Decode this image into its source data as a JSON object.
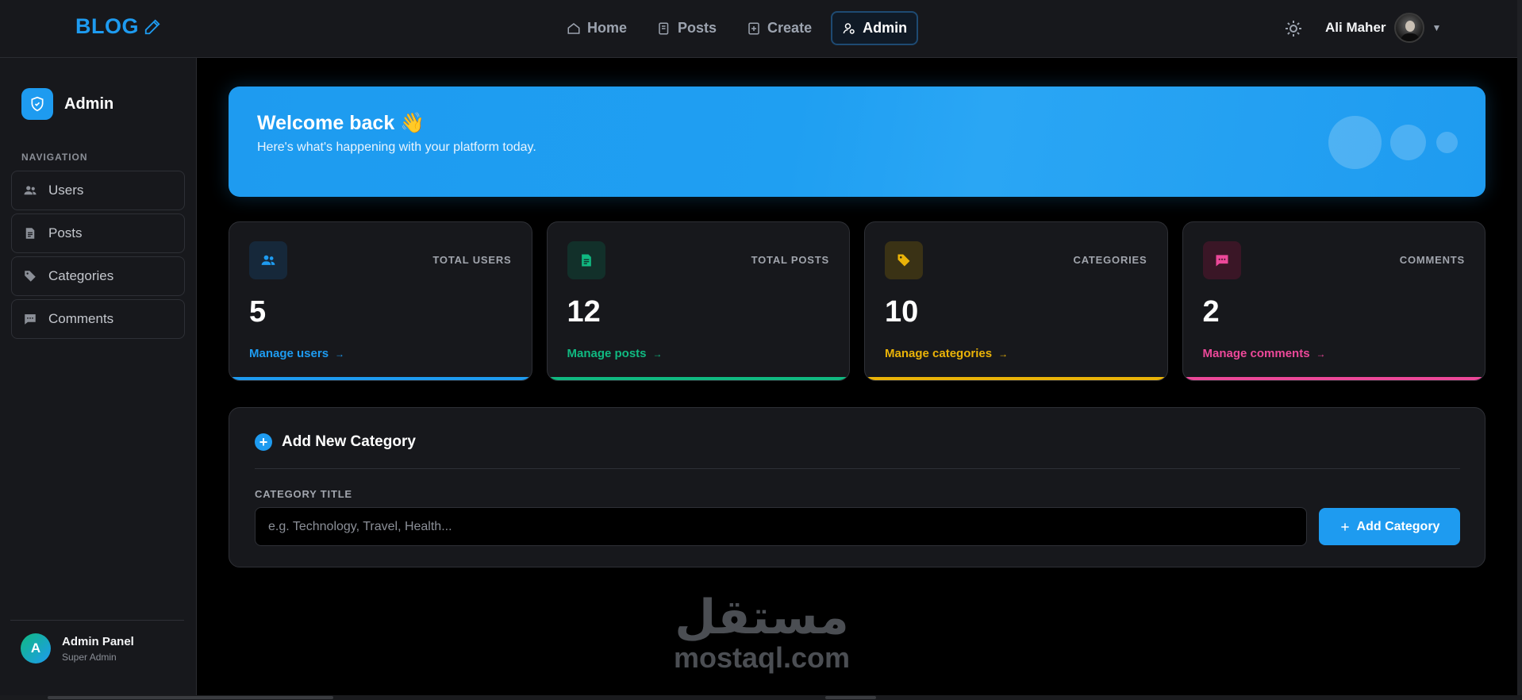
{
  "header": {
    "logo": "BLOG",
    "nav": [
      {
        "label": "Home",
        "icon": "home-icon",
        "active": false
      },
      {
        "label": "Posts",
        "icon": "posts-icon",
        "active": false
      },
      {
        "label": "Create",
        "icon": "create-icon",
        "active": false
      },
      {
        "label": "Admin",
        "icon": "admin-icon",
        "active": true
      }
    ],
    "user_name": "Ali Maher"
  },
  "sidebar": {
    "title": "Admin",
    "section_label": "NAVIGATION",
    "items": [
      {
        "label": "Users",
        "icon": "users-icon"
      },
      {
        "label": "Posts",
        "icon": "document-icon"
      },
      {
        "label": "Categories",
        "icon": "tag-icon"
      },
      {
        "label": "Comments",
        "icon": "comment-icon"
      }
    ],
    "footer": {
      "avatar_letter": "A",
      "title": "Admin Panel",
      "subtitle": "Super Admin"
    }
  },
  "welcome": {
    "title": "Welcome back 👋",
    "subtitle": "Here's what's happening with your platform today."
  },
  "stats": [
    {
      "label": "TOTAL USERS",
      "value": "5",
      "link": "Manage users",
      "color": "#1e9bf0",
      "icon": "users-icon"
    },
    {
      "label": "TOTAL POSTS",
      "value": "12",
      "link": "Manage posts",
      "color": "#10b981",
      "icon": "document-icon"
    },
    {
      "label": "CATEGORIES",
      "value": "10",
      "link": "Manage categories",
      "color": "#eab308",
      "icon": "tag-icon"
    },
    {
      "label": "COMMENTS",
      "value": "2",
      "link": "Manage comments",
      "color": "#ec4899",
      "icon": "comment-icon"
    }
  ],
  "add_category": {
    "title": "Add New Category",
    "field_label": "CATEGORY TITLE",
    "placeholder": "e.g. Technology, Travel, Health...",
    "button_label": "Add Category"
  },
  "watermark": {
    "arabic": "مستقل",
    "latin": "mostaql.com"
  },
  "colors": {
    "accent": "#1e9bf0",
    "background": "#000000",
    "panel": "#17181c"
  }
}
